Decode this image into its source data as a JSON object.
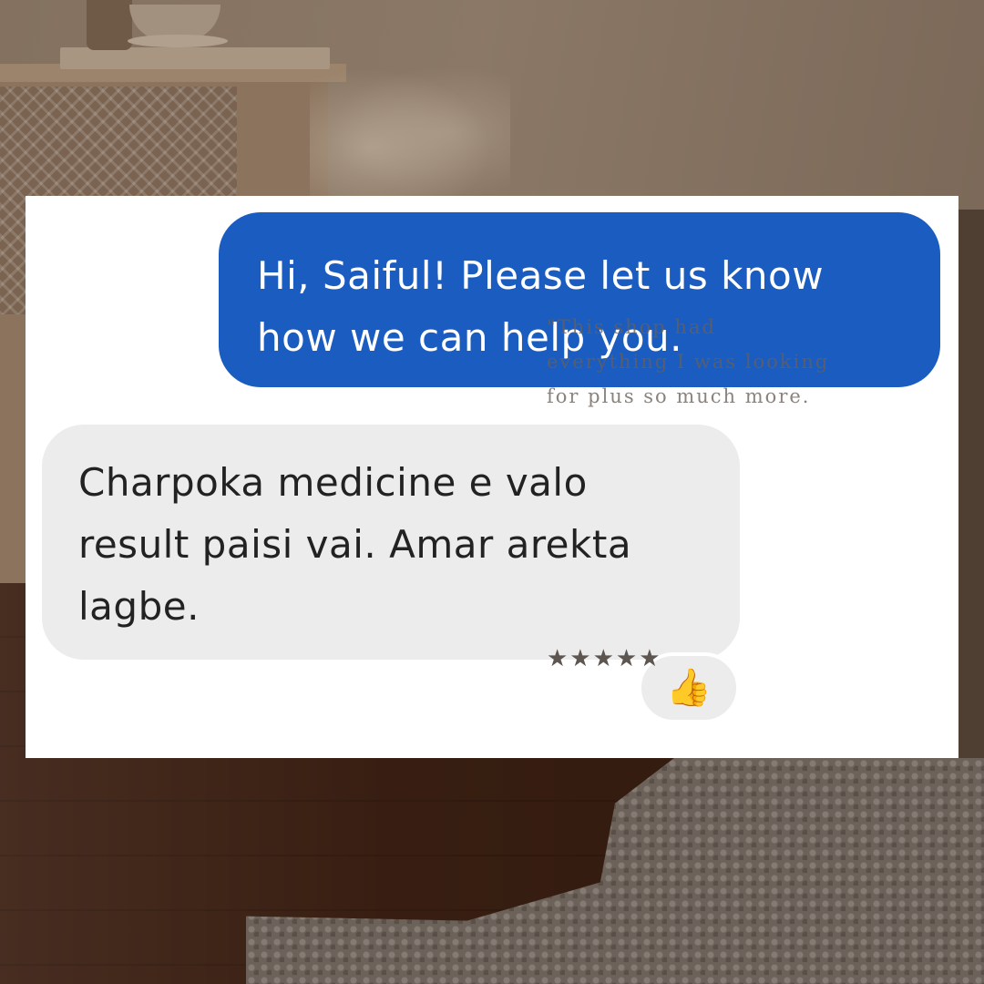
{
  "chat": {
    "outgoing_message": "Hi, Saiful! Please let us know\nhow we can help you.",
    "incoming_message": "Charpoka medicine e valo\nresult paisi vai. Amar arekta\nlagbe.",
    "reaction_emoji": "👍",
    "outgoing_color": "#1a5cc0",
    "incoming_color": "#ececec"
  },
  "testimonial": {
    "quote": "\"This shop had\neverything I was looking\nfor plus so much more.",
    "stars": "★★★★★",
    "rating": 5
  }
}
